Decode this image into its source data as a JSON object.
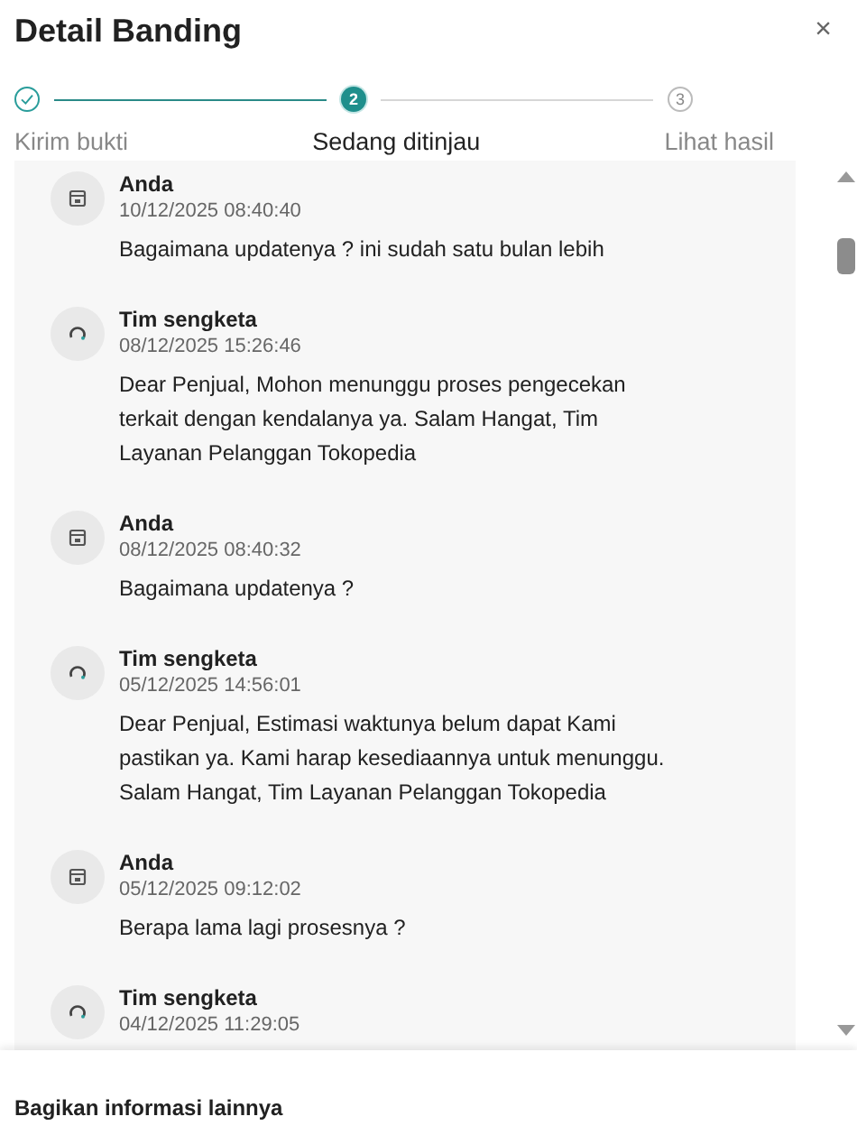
{
  "title": "Detail Banding",
  "close": "×",
  "steps": [
    {
      "label": "Kirim bukti",
      "kind": "done",
      "selected": false
    },
    {
      "label": "Sedang ditinjau",
      "number": "2",
      "kind": "current",
      "selected": true
    },
    {
      "label": "Lihat hasil",
      "number": "3",
      "kind": "upcoming",
      "selected": false
    }
  ],
  "messages": [
    {
      "kind": "user",
      "sender": "Anda",
      "time": "10/12/2025 08:40:40",
      "text": "Bagaimana updatenya ? ini sudah satu bulan lebih"
    },
    {
      "kind": "team",
      "sender": "Tim sengketa",
      "time": "08/12/2025 15:26:46",
      "text": "Dear Penjual, Mohon menunggu proses pengecekan terkait dengan kendalanya ya. Salam Hangat, Tim Layanan Pelanggan Tokopedia"
    },
    {
      "kind": "user",
      "sender": "Anda",
      "time": "08/12/2025 08:40:32",
      "text": "Bagaimana updatenya ?"
    },
    {
      "kind": "team",
      "sender": "Tim sengketa",
      "time": "05/12/2025 14:56:01",
      "text": "Dear Penjual, Estimasi waktunya belum dapat Kami pastikan ya. Kami harap kesediaannya untuk menunggu. Salam Hangat, Tim Layanan Pelanggan Tokopedia"
    },
    {
      "kind": "user",
      "sender": "Anda",
      "time": "05/12/2025 09:12:02",
      "text": "Berapa lama lagi prosesnya ?"
    },
    {
      "kind": "team",
      "sender": "Tim sengketa",
      "time": "04/12/2025 11:29:05"
    }
  ],
  "footer": {
    "label": "Bagikan informasi lainnya"
  }
}
